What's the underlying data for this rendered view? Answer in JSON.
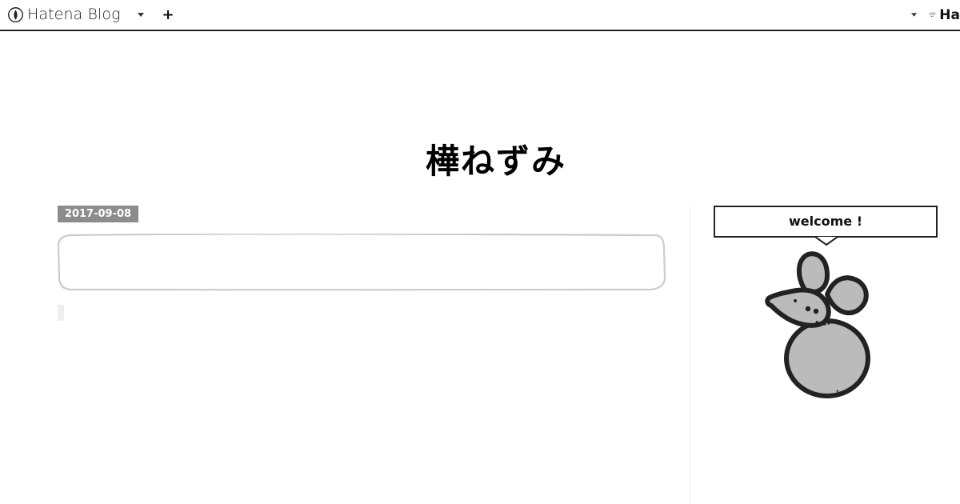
{
  "topbar": {
    "brand_label": "Hatena Blog",
    "add_label": "+",
    "right_brand_label": "Ha",
    "icons": [
      "hatena-logo-icon",
      "caret-down-icon",
      "plus-icon",
      "caret-down-icon",
      "hatena-logo-icon"
    ]
  },
  "blog": {
    "title": "樺ねずみ"
  },
  "entry": {
    "date": "2017-09-08",
    "title": ""
  },
  "sidebar": {
    "welcome_label": "welcome !",
    "illustration": "mouse-illustration"
  },
  "colors": {
    "date_badge_bg": "#8c8c8c",
    "topbar_border": "#222222",
    "mouse_fill": "#bbbbbb",
    "mouse_outline": "#222222",
    "box_outline": "#cccccc"
  }
}
